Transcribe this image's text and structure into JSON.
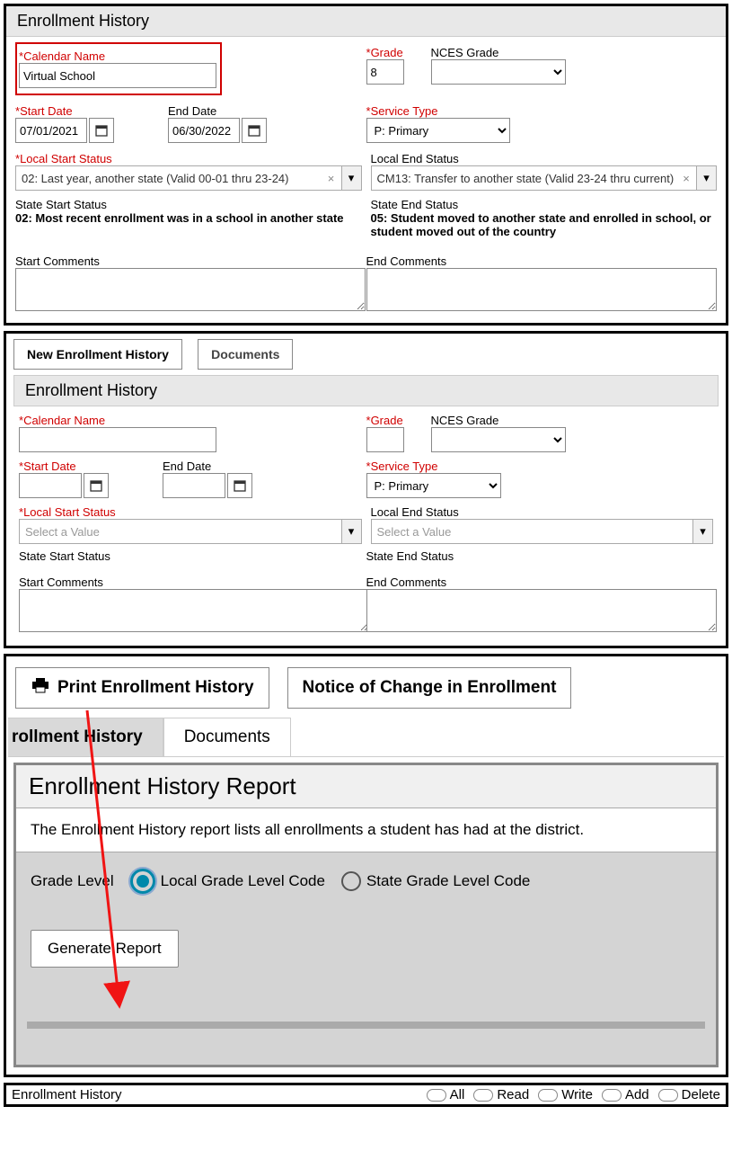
{
  "panel1": {
    "title": "Enrollment History",
    "labels": {
      "calendar_name": "Calendar Name",
      "grade": "Grade",
      "nces_grade": "NCES Grade",
      "start_date": "Start Date",
      "end_date": "End Date",
      "service_type": "Service Type",
      "local_start_status": "Local Start Status",
      "local_end_status": "Local End Status",
      "state_start_status": "State Start Status",
      "state_end_status": "State End Status",
      "start_comments": "Start Comments",
      "end_comments": "End Comments"
    },
    "values": {
      "calendar_name": "Virtual School",
      "grade": "8",
      "nces_grade": "",
      "start_date": "07/01/2021",
      "end_date": "06/30/2022",
      "service_type": "P: Primary",
      "local_start_status": "02: Last year, another state (Valid 00-01 thru 23-24)",
      "local_end_status": "CM13: Transfer to another state (Valid 23-24 thru current)",
      "state_start_status": "02: Most recent enrollment was in a school in another state",
      "state_end_status": "05: Student moved to another state and enrolled in school, or student moved out of the country",
      "start_comments": "",
      "end_comments": ""
    }
  },
  "panel2": {
    "tabs": {
      "new": "New Enrollment History",
      "documents": "Documents"
    },
    "title": "Enrollment History",
    "service_type_default": "P: Primary",
    "combo_placeholder": "Select a Value"
  },
  "panel3": {
    "buttons": {
      "print": "Print Enrollment History",
      "notice": "Notice of Change in Enrollment"
    },
    "tabs": {
      "history": "rollment History",
      "documents": "Documents"
    },
    "report": {
      "title": "Enrollment History Report",
      "desc": "The Enrollment History report lists all enrollments a student has had at the district.",
      "grade_level_label": "Grade Level",
      "radio_local": "Local Grade Level Code",
      "radio_state": "State Grade Level Code",
      "generate": "Generate Report"
    }
  },
  "footer": {
    "title": "Enrollment History",
    "perms": [
      "All",
      "Read",
      "Write",
      "Add",
      "Delete"
    ]
  }
}
